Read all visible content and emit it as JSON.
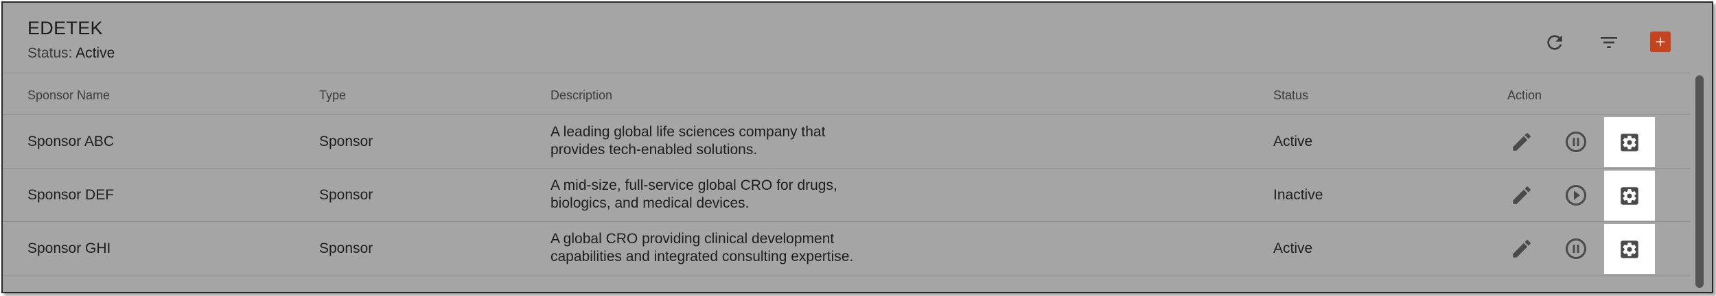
{
  "header": {
    "title": "EDETEK",
    "status_label": "Status:",
    "status_value": "Active",
    "actions": [
      {
        "name": "refresh",
        "icon": "refresh-icon"
      },
      {
        "name": "filter",
        "icon": "filter-icon"
      },
      {
        "name": "add",
        "icon": "plus-icon"
      }
    ]
  },
  "table": {
    "columns": [
      "Sponsor Name",
      "Type",
      "Description",
      "Status",
      "Action"
    ],
    "rows": [
      {
        "name": "Sponsor ABC",
        "type": "Sponsor",
        "description_line1": "A leading global life sciences company that",
        "description_line2": "provides tech-enabled solutions.",
        "status": "Active",
        "toggle_icon": "pause-icon"
      },
      {
        "name": "Sponsor DEF",
        "type": "Sponsor",
        "description_line1": "A mid-size, full-service global CRO for drugs,",
        "description_line2": "biologics, and medical devices.",
        "status": "Inactive",
        "toggle_icon": "play-icon"
      },
      {
        "name": "Sponsor GHI",
        "type": "Sponsor",
        "description_line1": "A global CRO providing clinical development",
        "description_line2": "capabilities and integrated consulting expertise.",
        "status": "Active",
        "toggle_icon": "pause-icon"
      }
    ]
  },
  "colors": {
    "overlay_background": "#a5a5a5",
    "add_button": "#c4441f",
    "highlight": "#ffffff",
    "icon": "#4a4a4a"
  }
}
